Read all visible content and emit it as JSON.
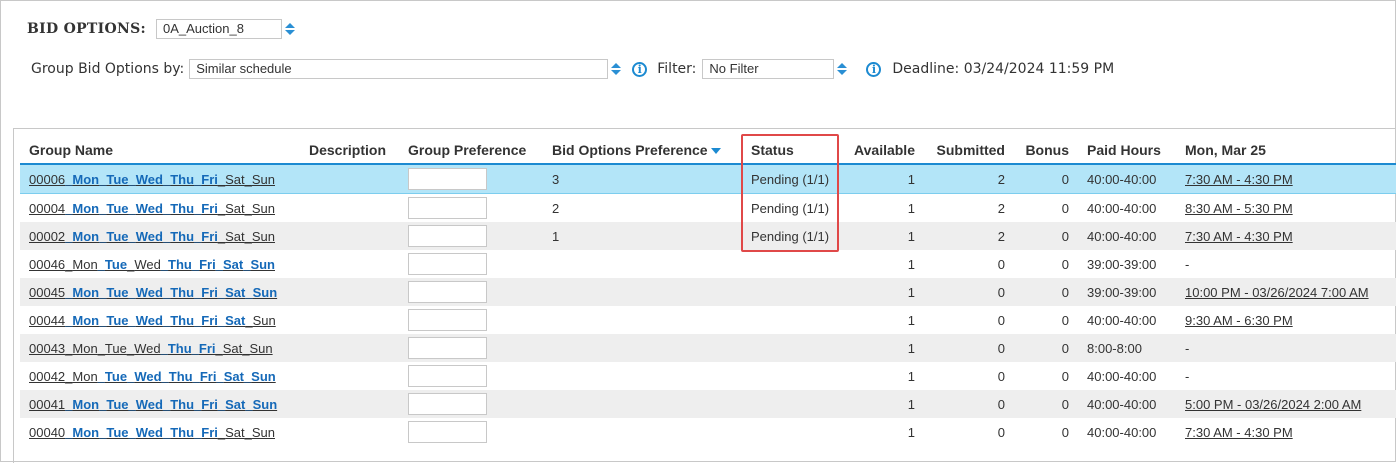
{
  "bid_options": {
    "label": "BID OPTIONS:",
    "selected": "0A_Auction_8"
  },
  "group_by": {
    "label": "Group Bid Options by:",
    "selected": "Similar schedule"
  },
  "filter": {
    "label": "Filter:",
    "selected": "No Filter"
  },
  "deadline": "Deadline: 03/24/2024 11:59 PM",
  "table": {
    "headers": {
      "group_name": "Group Name",
      "description": "Description",
      "group_preference": "Group Preference",
      "bid_options_preference": "Bid Options Preference",
      "status": "Status",
      "available": "Available",
      "submitted": "Submitted",
      "bonus": "Bonus",
      "paid_hours": "Paid Hours",
      "mon": "Mon, Mar 25"
    },
    "rows": [
      {
        "id": "00006",
        "days": [
          [
            "Mon",
            1
          ],
          [
            "Tue",
            1
          ],
          [
            "Wed",
            1
          ],
          [
            "Thu",
            1
          ],
          [
            "Fri",
            1
          ],
          [
            "Sat",
            0
          ],
          [
            "Sun",
            0
          ]
        ],
        "pref": "3",
        "status": "Pending (1/1)",
        "available": "1",
        "submitted": "2",
        "bonus": "0",
        "paid": "40:00-40:00",
        "mon": "7:30 AM - 4:30 PM"
      },
      {
        "id": "00004",
        "days": [
          [
            "Mon",
            1
          ],
          [
            "Tue",
            1
          ],
          [
            "Wed",
            1
          ],
          [
            "Thu",
            1
          ],
          [
            "Fri",
            1
          ],
          [
            "Sat",
            0
          ],
          [
            "Sun",
            0
          ]
        ],
        "pref": "2",
        "status": "Pending (1/1)",
        "available": "1",
        "submitted": "2",
        "bonus": "0",
        "paid": "40:00-40:00",
        "mon": "8:30 AM - 5:30 PM"
      },
      {
        "id": "00002",
        "days": [
          [
            "Mon",
            1
          ],
          [
            "Tue",
            1
          ],
          [
            "Wed",
            1
          ],
          [
            "Thu",
            1
          ],
          [
            "Fri",
            1
          ],
          [
            "Sat",
            0
          ],
          [
            "Sun",
            0
          ]
        ],
        "pref": "1",
        "status": "Pending (1/1)",
        "available": "1",
        "submitted": "2",
        "bonus": "0",
        "paid": "40:00-40:00",
        "mon": "7:30 AM - 4:30 PM"
      },
      {
        "id": "00046",
        "days": [
          [
            "Mon",
            0
          ],
          [
            "Tue",
            1
          ],
          [
            "Wed",
            0
          ],
          [
            "Thu",
            1
          ],
          [
            "Fri",
            1
          ],
          [
            "Sat",
            1
          ],
          [
            "Sun",
            1
          ]
        ],
        "pref": "",
        "status": "",
        "available": "1",
        "submitted": "0",
        "bonus": "0",
        "paid": "39:00-39:00",
        "mon": "-"
      },
      {
        "id": "00045",
        "days": [
          [
            "Mon",
            1
          ],
          [
            "Tue",
            1
          ],
          [
            "Wed",
            1
          ],
          [
            "Thu",
            1
          ],
          [
            "Fri",
            1
          ],
          [
            "Sat",
            1
          ],
          [
            "Sun",
            1
          ]
        ],
        "pref": "",
        "status": "",
        "available": "1",
        "submitted": "0",
        "bonus": "0",
        "paid": "39:00-39:00",
        "mon": "10:00 PM - 03/26/2024 7:00 AM"
      },
      {
        "id": "00044",
        "days": [
          [
            "Mon",
            1
          ],
          [
            "Tue",
            1
          ],
          [
            "Wed",
            1
          ],
          [
            "Thu",
            1
          ],
          [
            "Fri",
            1
          ],
          [
            "Sat",
            1
          ],
          [
            "Sun",
            0
          ]
        ],
        "pref": "",
        "status": "",
        "available": "1",
        "submitted": "0",
        "bonus": "0",
        "paid": "40:00-40:00",
        "mon": "9:30 AM - 6:30 PM"
      },
      {
        "id": "00043",
        "days": [
          [
            "Mon",
            0
          ],
          [
            "Tue",
            0
          ],
          [
            "Wed",
            0
          ],
          [
            "Thu",
            1
          ],
          [
            "Fri",
            1
          ],
          [
            "Sat",
            0
          ],
          [
            "Sun",
            0
          ]
        ],
        "pref": "",
        "status": "",
        "available": "1",
        "submitted": "0",
        "bonus": "0",
        "paid": "8:00-8:00",
        "mon": "-"
      },
      {
        "id": "00042",
        "days": [
          [
            "Mon",
            0
          ],
          [
            "Tue",
            1
          ],
          [
            "Wed",
            1
          ],
          [
            "Thu",
            1
          ],
          [
            "Fri",
            1
          ],
          [
            "Sat",
            1
          ],
          [
            "Sun",
            1
          ]
        ],
        "pref": "",
        "status": "",
        "available": "1",
        "submitted": "0",
        "bonus": "0",
        "paid": "40:00-40:00",
        "mon": "-"
      },
      {
        "id": "00041",
        "days": [
          [
            "Mon",
            1
          ],
          [
            "Tue",
            1
          ],
          [
            "Wed",
            1
          ],
          [
            "Thu",
            1
          ],
          [
            "Fri",
            1
          ],
          [
            "Sat",
            1
          ],
          [
            "Sun",
            1
          ]
        ],
        "pref": "",
        "status": "",
        "available": "1",
        "submitted": "0",
        "bonus": "0",
        "paid": "40:00-40:00",
        "mon": "5:00 PM - 03/26/2024 2:00 AM"
      },
      {
        "id": "00040",
        "days": [
          [
            "Mon",
            1
          ],
          [
            "Tue",
            1
          ],
          [
            "Wed",
            1
          ],
          [
            "Thu",
            1
          ],
          [
            "Fri",
            1
          ],
          [
            "Sat",
            0
          ],
          [
            "Sun",
            0
          ]
        ],
        "pref": "",
        "status": "",
        "available": "1",
        "submitted": "0",
        "bonus": "0",
        "paid": "40:00-40:00",
        "mon": "7:30 AM - 4:30 PM"
      }
    ]
  },
  "colors": {
    "accent": "#1c8ad1",
    "link_highlight": "#1569b8",
    "selected_row": "#b3e5f8",
    "alt_row": "#eeeeee",
    "status_outline": "#e04848"
  }
}
